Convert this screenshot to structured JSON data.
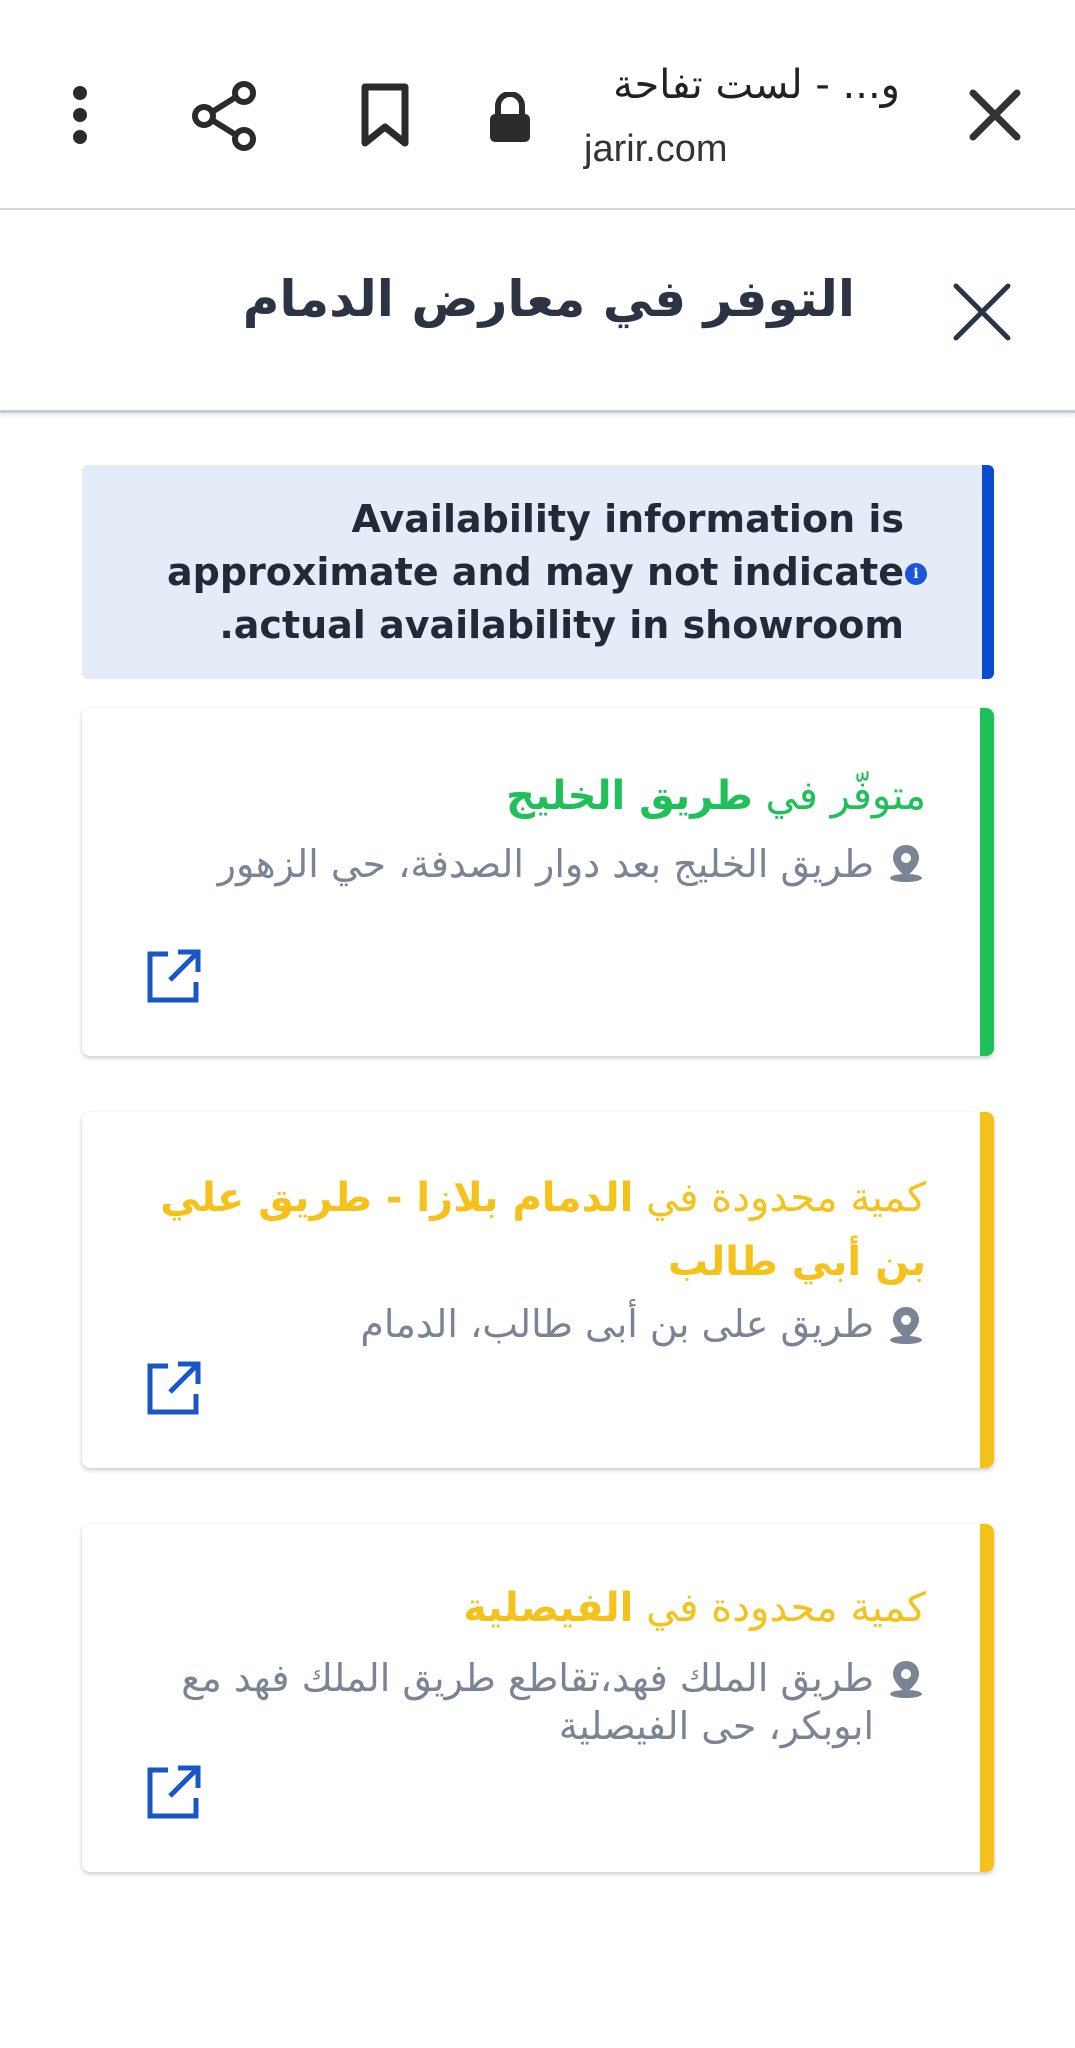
{
  "browser": {
    "tab_title": "و... - لست تفاحة",
    "url": "jarir.com"
  },
  "sheet": {
    "title": "التوفر في معارض الدمام"
  },
  "info_banner": {
    "line1": "Availability information is",
    "line2": "approximate and may not indicate",
    "line3": "actual availability in showroom."
  },
  "stores": [
    {
      "status_prefix": "متوفّر في",
      "store_name": "طريق الخليج",
      "address": "طريق الخليج بعد دوار الصدفة، حي الزهور",
      "color": "#1fbf5a"
    },
    {
      "status_prefix": "كمية محدودة في",
      "store_name": "الدمام بلازا - طريق علي بن أبي طالب",
      "address": "طريق على بن أبى طالب، الدمام",
      "color": "#f5c21b"
    },
    {
      "status_prefix": "كمية محدودة في",
      "store_name": "الفيصلية",
      "address": "طريق الملك فهد،تقاطع طريق الملك فهد مع ابوبكر، حى الفيصلية",
      "color": "#f5c21b"
    }
  ],
  "icons": {
    "close": "close-icon",
    "lock": "lock-icon",
    "bookmark": "bookmark-icon",
    "share": "share-icon",
    "menu": "more-vert-icon",
    "info": "info-icon",
    "pin": "location-pin-icon",
    "external": "open-external-icon"
  }
}
